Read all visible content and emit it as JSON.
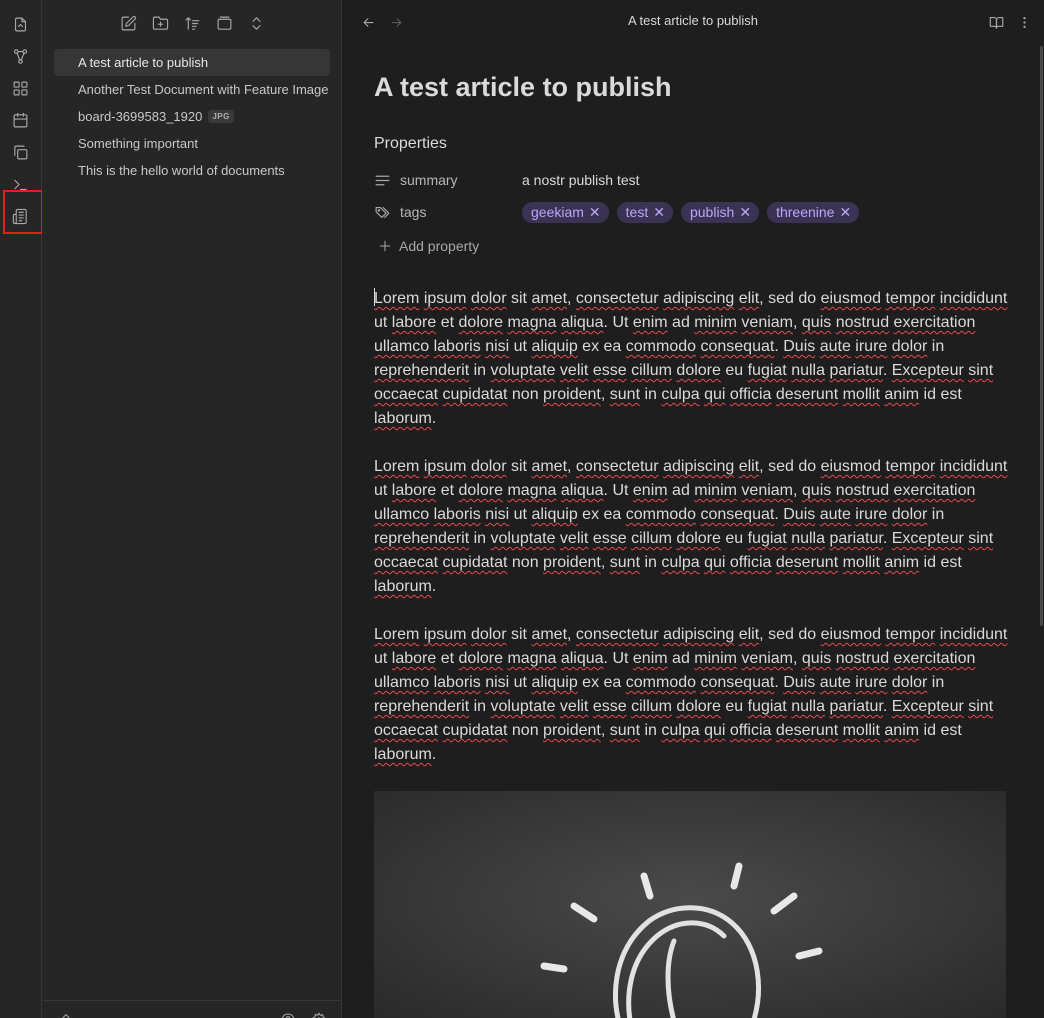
{
  "window": {
    "title": "A test article to publish"
  },
  "ribbon": {
    "items": [
      {
        "icon": "open-quick-switcher-icon"
      },
      {
        "icon": "graph-view-icon"
      },
      {
        "icon": "canvas-icon"
      },
      {
        "icon": "daily-note-icon"
      },
      {
        "icon": "templates-icon"
      },
      {
        "icon": "command-palette-icon"
      },
      {
        "icon": "nostr-publish-icon"
      }
    ]
  },
  "sidebar": {
    "toolbar": [
      "new-note-icon",
      "new-folder-icon",
      "sort-icon",
      "collapse-icon",
      "expand-icon"
    ],
    "files": [
      {
        "name": "A test article to publish",
        "active": true
      },
      {
        "name": "Another Test Document with Feature Image"
      },
      {
        "name": "board-3699583_1920",
        "badge": "JPG"
      },
      {
        "name": "Something important"
      },
      {
        "name": "This is the hello world of documents"
      }
    ]
  },
  "main": {
    "nav": {
      "back_icon": "arrow-left-icon",
      "forward_icon": "arrow-right-icon"
    },
    "title": "A test article to publish",
    "actions": [
      "reading-view-icon",
      "more-options-icon"
    ]
  },
  "document": {
    "title": "A test article to publish",
    "properties": {
      "heading": "Properties",
      "summary": {
        "key": "summary",
        "value": "a nostr publish test"
      },
      "tags": {
        "key": "tags",
        "values": [
          "geekiam",
          "test",
          "publish",
          "threenine"
        ]
      },
      "add_label": "Add property"
    },
    "paragraphs": [
      "Lorem ipsum dolor sit amet, consectetur adipiscing elit, sed do eiusmod tempor incididunt ut labore et dolore magna aliqua. Ut enim ad minim veniam, quis nostrud exercitation ullamco laboris nisi ut aliquip ex ea commodo consequat. Duis aute irure dolor in reprehenderit in voluptate velit esse cillum dolore eu fugiat nulla pariatur. Excepteur sint occaecat cupidatat non proident, sunt in culpa qui officia deserunt mollit anim id est laborum.",
      "Lorem ipsum dolor sit amet, consectetur adipiscing elit, sed do eiusmod tempor incididunt ut labore et dolore magna aliqua. Ut enim ad minim veniam, quis nostrud exercitation ullamco laboris nisi ut aliquip ex ea commodo consequat. Duis aute irure dolor in reprehenderit in voluptate velit esse cillum dolore eu fugiat nulla pariatur. Excepteur sint occaecat cupidatat non proident, sunt in culpa qui officia deserunt mollit anim id est laborum.",
      "Lorem ipsum dolor sit amet, consectetur adipiscing elit, sed do eiusmod tempor incididunt ut labore et dolore magna aliqua. Ut enim ad minim veniam, quis nostrud exercitation ullamco laboris nisi ut aliquip ex ea commodo consequat. Duis aute irure dolor in reprehenderit in voluptate velit esse cillum dolore eu fugiat nulla pariatur. Excepteur sint occaecat cupidatat non proident, sunt in culpa qui officia deserunt mollit anim id est laborum."
    ],
    "misspelled": [
      "Lorem",
      "ipsum",
      "dolor",
      "amet",
      "consectetur",
      "adipiscing",
      "elit",
      "eiusmod",
      "tempor",
      "incididunt",
      "labore",
      "dolore",
      "magna",
      "aliqua",
      "enim",
      "minim",
      "veniam",
      "quis",
      "nostrud",
      "exercitation",
      "ullamco",
      "laboris",
      "nisi",
      "aliquip",
      "commodo",
      "consequat",
      "Duis",
      "aute",
      "irure",
      "reprehenderit",
      "voluptate",
      "velit",
      "esse",
      "cillum",
      "fugiat",
      "nulla",
      "pariatur",
      "Excepteur",
      "sint",
      "occaecat",
      "cupidatat",
      "proident",
      "sunt",
      "culpa",
      "qui",
      "officia",
      "deserunt",
      "mollit",
      "anim",
      "laborum"
    ],
    "image": {
      "description_icon": "lightbulb-chalkboard-image"
    }
  },
  "colors": {
    "accent_tag_bg": "#3b3354",
    "accent_tag_text": "#b9a7f7",
    "spellcheck": "#e24a4a",
    "highlight": "#e0201c"
  }
}
